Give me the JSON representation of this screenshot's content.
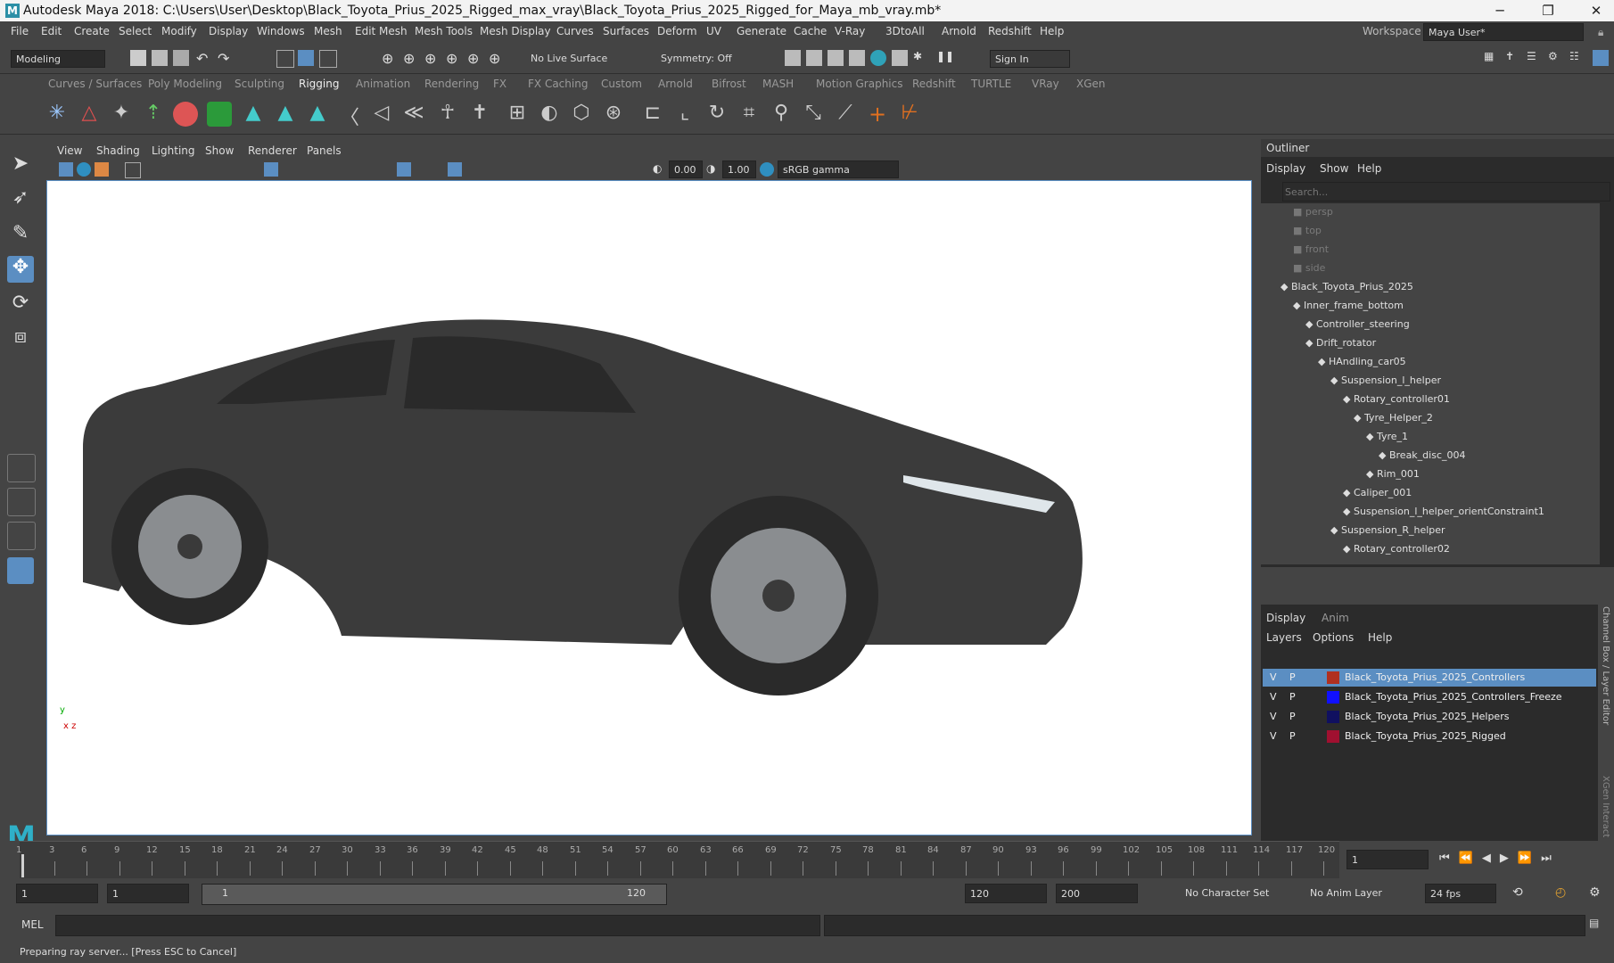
{
  "window": {
    "title": "Autodesk Maya 2018: C:\\Users\\User\\Desktop\\Black_Toyota_Prius_2025_Rigged_max_vray\\Black_Toyota_Prius_2025_Rigged_for_Maya_mb_vray.mb*",
    "minimize": "─",
    "restore": "❐",
    "close": "✕"
  },
  "menubar": {
    "items": [
      "File",
      "Edit",
      "Create",
      "Select",
      "Modify",
      "Display",
      "Windows",
      "Mesh",
      "Edit Mesh",
      "Mesh Tools",
      "Mesh Display",
      "Curves",
      "Surfaces",
      "Deform",
      "UV",
      "Generate",
      "Cache",
      "V-Ray",
      "3DtoAll",
      "Arnold",
      "Redshift",
      "Help"
    ],
    "workspace_label": "Workspace :",
    "workspace_value": "Maya User*"
  },
  "statusline": {
    "mode": "Modeling",
    "live_surface": "No Live Surface",
    "symmetry": "Symmetry: Off",
    "sign_in": "Sign In"
  },
  "shelf": {
    "tabs": [
      "Curves / Surfaces",
      "Poly Modeling",
      "Sculpting",
      "Rigging",
      "Animation",
      "Rendering",
      "FX",
      "FX Caching",
      "Custom",
      "Arnold",
      "Bifrost",
      "MASH",
      "Motion Graphics",
      "Redshift",
      "TURTLE",
      "VRay",
      "XGen"
    ],
    "active_tab": "Rigging"
  },
  "viewport": {
    "menus": [
      "View",
      "Shading",
      "Lighting",
      "Show",
      "Renderer",
      "Panels"
    ],
    "exposure": "0.00",
    "gamma": "1.00",
    "color_space": "sRGB gamma",
    "axis_y": "y",
    "axis_xz": "x z"
  },
  "outliner": {
    "title": "Outliner",
    "menus": [
      "Display",
      "Show",
      "Help"
    ],
    "search_placeholder": "Search...",
    "items": [
      {
        "label": "persp",
        "dim": true
      },
      {
        "label": "top",
        "dim": true
      },
      {
        "label": "front",
        "dim": true
      },
      {
        "label": "side",
        "dim": true
      },
      {
        "label": "Black_Toyota_Prius_2025"
      },
      {
        "label": "Inner_frame_bottom"
      },
      {
        "label": "Controller_steering"
      },
      {
        "label": "Drift_rotator"
      },
      {
        "label": "HAndling_car05"
      },
      {
        "label": "Suspension_l_helper"
      },
      {
        "label": "Rotary_controller01"
      },
      {
        "label": "Tyre_Helper_2"
      },
      {
        "label": "Tyre_1"
      },
      {
        "label": "Break_disc_004"
      },
      {
        "label": "Rim_001"
      },
      {
        "label": "Caliper_001"
      },
      {
        "label": "Suspension_l_helper_orientConstraint1"
      },
      {
        "label": "Suspension_R_helper"
      },
      {
        "label": "Rotary_controller02"
      }
    ]
  },
  "layers": {
    "tabs": [
      "Display",
      "Anim"
    ],
    "menus": [
      "Layers",
      "Options",
      "Help"
    ],
    "side_label": "Channel Box / Layer Editor",
    "side_label2": "XGen Interactive G...",
    "rows": [
      {
        "v": "V",
        "p": "P",
        "name": "Black_Toyota_Prius_2025_Controllers",
        "color": "#b03020",
        "selected": true
      },
      {
        "v": "V",
        "p": "P",
        "name": "Black_Toyota_Prius_2025_Controllers_Freeze",
        "color": "#1010ff"
      },
      {
        "v": "V",
        "p": "P",
        "name": "Black_Toyota_Prius_2025_Helpers",
        "color": "#101060"
      },
      {
        "v": "V",
        "p": "P",
        "name": "Black_Toyota_Prius_2025_Rigged",
        "color": "#a01030"
      }
    ]
  },
  "timeline": {
    "ticks": [
      "1",
      "3",
      "6",
      "9",
      "12",
      "15",
      "18",
      "21",
      "24",
      "27",
      "30",
      "33",
      "36",
      "39",
      "42",
      "45",
      "48",
      "51",
      "54",
      "57",
      "60",
      "63",
      "66",
      "69",
      "72",
      "75",
      "78",
      "81",
      "84",
      "87",
      "90",
      "93",
      "96",
      "99",
      "102",
      "105",
      "108",
      "111",
      "114",
      "117",
      "120"
    ],
    "current_frame": "1",
    "range_start": "1",
    "range_start_inner": "1",
    "slider_start": "1",
    "slider_end": "120",
    "range_end": "120",
    "anim_end": "200",
    "character_set": "No Character Set",
    "anim_layer": "No Anim Layer",
    "fps": "24 fps"
  },
  "cmdline": {
    "label": "MEL"
  },
  "helpline": {
    "text": "Preparing ray server... [Press ESC to Cancel]"
  }
}
